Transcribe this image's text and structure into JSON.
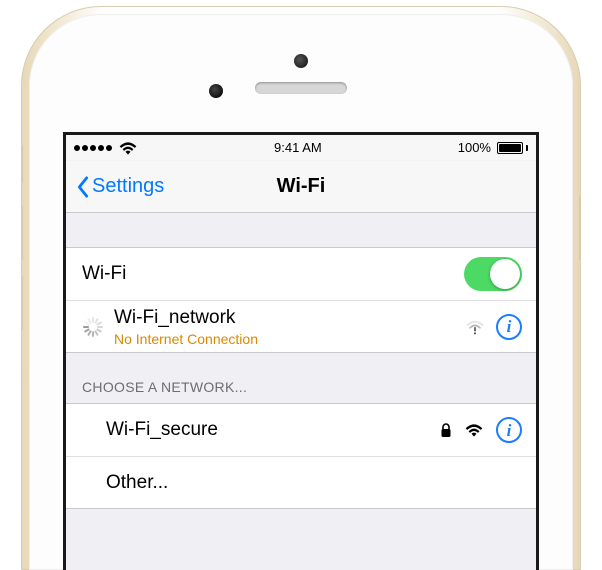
{
  "statusbar": {
    "time": "9:41 AM",
    "battery_pct": "100%"
  },
  "nav": {
    "back_label": "Settings",
    "title": "Wi-Fi"
  },
  "wifi_toggle": {
    "label": "Wi-Fi",
    "on": true
  },
  "current_network": {
    "name": "Wi-Fi_network",
    "status": "No Internet Connection"
  },
  "choose_header": "CHOOSE A NETWORK...",
  "networks": [
    {
      "name": "Wi-Fi_secure",
      "secured": true
    }
  ],
  "other_label": "Other...",
  "colors": {
    "tint": "#007aff",
    "toggle_on": "#4cd964",
    "warning_text": "#d88a00"
  }
}
